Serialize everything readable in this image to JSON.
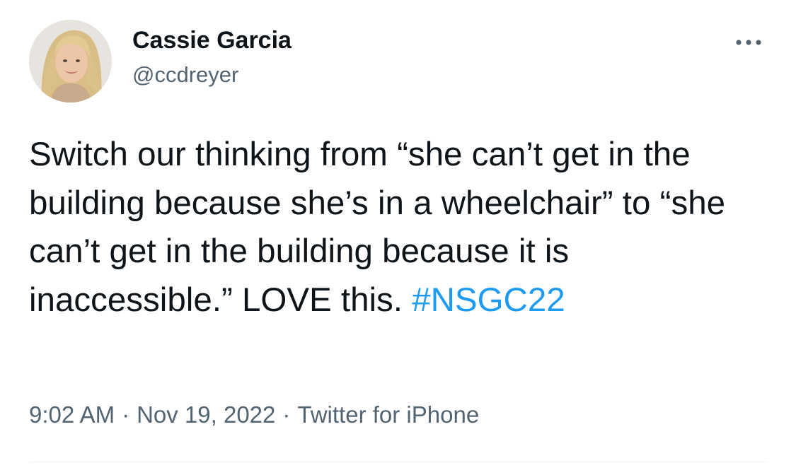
{
  "author": {
    "display_name": "Cassie Garcia",
    "handle": "@ccdreyer"
  },
  "tweet": {
    "text_before_hashtag": "Switch our thinking from “she can’t get in the building because she’s in a wheelchair” to “she can’t get in the building because it is inaccessible.” LOVE this. ",
    "hashtag": "#NSGC22"
  },
  "meta": {
    "time": "9:02 AM",
    "separator": "·",
    "date": "Nov 19, 2022",
    "source": "Twitter for iPhone"
  },
  "icons": {
    "avatar": "avatar-photo",
    "more": "more-options-icon"
  },
  "colors": {
    "text": "#0f1419",
    "secondary": "#536471",
    "hashtag": "#1d9bf0",
    "divider": "#eff3f4",
    "background": "#ffffff"
  }
}
